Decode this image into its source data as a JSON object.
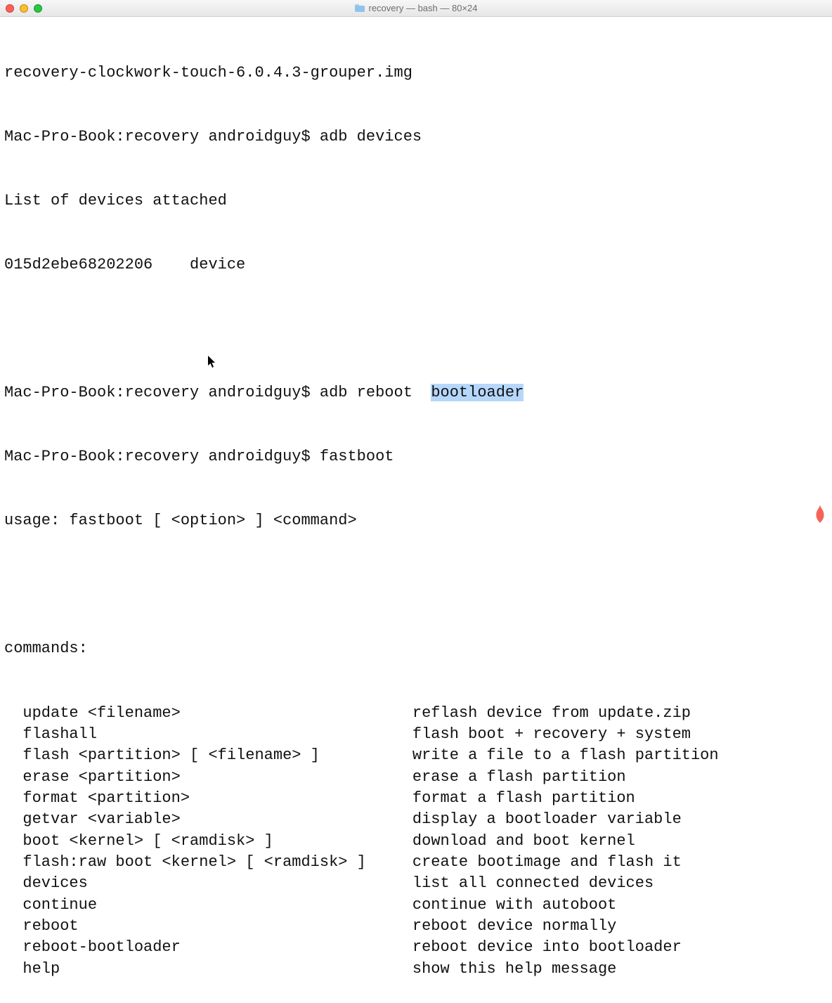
{
  "window": {
    "title": "recovery — bash — 80×24"
  },
  "terminal": {
    "line1": "recovery-clockwork-touch-6.0.4.3-grouper.img",
    "prompt": "Mac-Pro-Book:recovery androidguy$ ",
    "cmd_adb_devices": "adb devices",
    "list_header": "List of devices attached",
    "device_id": "015d2ebe68202206",
    "device_state": "device",
    "cmd_adb_reboot_pre": "adb reboot  ",
    "cmd_adb_reboot_arg": "bootloader",
    "cmd_fastboot": "fastboot",
    "usage_line": "usage: fastboot [ <option> ] <command>",
    "commands_header": "commands:",
    "commands": [
      {
        "left": "  update <filename>",
        "right": "reflash device from update.zip"
      },
      {
        "left": "  flashall",
        "right": "flash boot + recovery + system"
      },
      {
        "left": "  flash <partition> [ <filename> ]",
        "right": "write a file to a flash partition"
      },
      {
        "left": "  erase <partition>",
        "right": "erase a flash partition"
      },
      {
        "left": "  format <partition>",
        "right": "format a flash partition"
      },
      {
        "left": "  getvar <variable>",
        "right": "display a bootloader variable"
      },
      {
        "left": "  boot <kernel> [ <ramdisk> ]",
        "right": "download and boot kernel"
      },
      {
        "left": "  flash:raw boot <kernel> [ <ramdisk> ]",
        "right": "create bootimage and flash it"
      },
      {
        "left": "  devices",
        "right": "list all connected devices"
      },
      {
        "left": "  continue",
        "right": "continue with autoboot"
      },
      {
        "left": "  reboot",
        "right": "reboot device normally"
      },
      {
        "left": "  reboot-bootloader",
        "right": "reboot device into bootloader"
      },
      {
        "left": "  help",
        "right": "show this help message"
      }
    ]
  },
  "layout": {
    "cmd_column": 44,
    "device_state_column": 18
  }
}
